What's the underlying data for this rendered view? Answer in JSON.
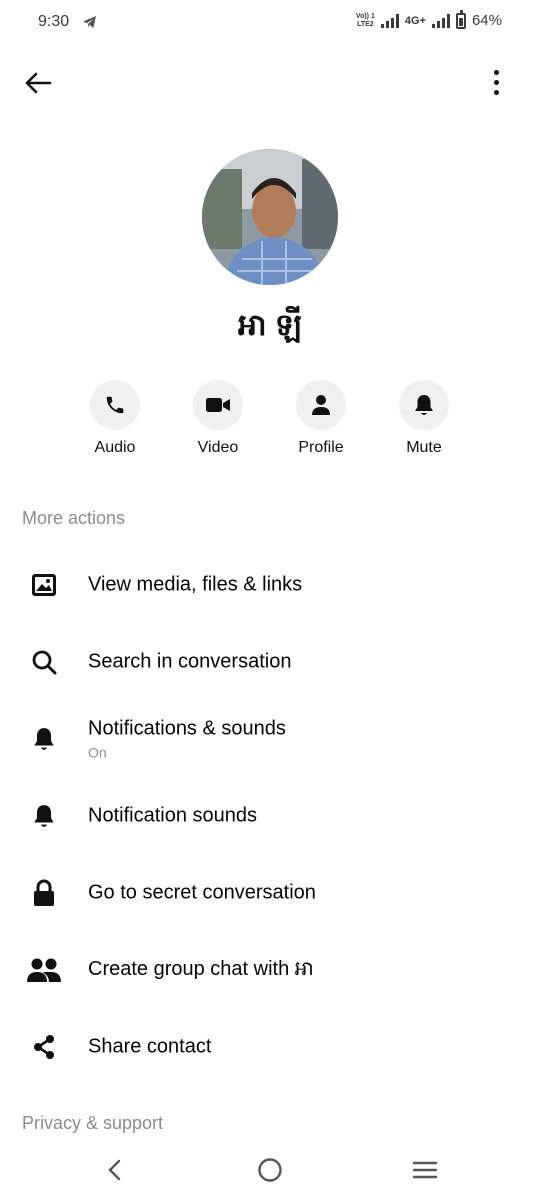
{
  "status_bar": {
    "time": "9:30",
    "volte_line1": "Vo)) 1",
    "volte_line2": "LTE2",
    "network": "4G+",
    "battery": "64%",
    "battery_level": 0.64
  },
  "profile": {
    "name": "អា ឡី"
  },
  "actions": [
    {
      "label": "Audio",
      "icon": "phone-icon"
    },
    {
      "label": "Video",
      "icon": "video-camera-icon"
    },
    {
      "label": "Profile",
      "icon": "person-icon"
    },
    {
      "label": "Mute",
      "icon": "bell-icon"
    }
  ],
  "sections": {
    "more_actions": "More actions",
    "privacy_support": "Privacy & support"
  },
  "menu": [
    {
      "title": "View media, files & links",
      "icon": "image-icon"
    },
    {
      "title": "Search in conversation",
      "icon": "search-icon"
    },
    {
      "title": "Notifications & sounds",
      "subtitle": "On",
      "icon": "bell-icon"
    },
    {
      "title": "Notification sounds",
      "icon": "bell-icon"
    },
    {
      "title": "Go to secret conversation",
      "icon": "lock-icon"
    },
    {
      "title": "Create group chat with អា",
      "icon": "people-icon"
    },
    {
      "title": "Share contact",
      "icon": "share-icon"
    }
  ],
  "colors": {
    "text": "#050505",
    "secondary": "#8a8d91",
    "button_bg": "#f0f0f0"
  }
}
